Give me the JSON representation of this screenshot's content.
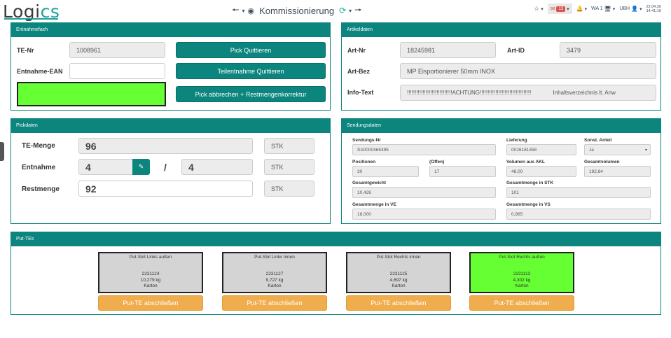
{
  "header": {
    "logo_text_1": "Logi",
    "logo_text_2": "cs",
    "title": "Kommissionierung",
    "mail_count": "13",
    "user_wa": "WA 1",
    "user_name": "UBH",
    "date": "22.04.26",
    "time": "14:41:16"
  },
  "entnahmefach": {
    "heading": "Entnahmefach",
    "te_nr_label": "TE-Nr",
    "te_nr_value": "1008961",
    "ean_label": "Entnahme-EAN",
    "ean_value": "",
    "status_color": "#66ff33",
    "btn_pick": "Pick Quittieren",
    "btn_teil": "Teilentnahme Quittieren",
    "btn_abbrechen": "Pick abbrechen + Restmengenkorrektur"
  },
  "artikeldaten": {
    "heading": "Artikeldaten",
    "art_nr_label": "Art-Nr",
    "art_nr_value": "18245981",
    "art_id_label": "Art-ID",
    "art_id_value": "3479",
    "art_bez_label": "Art-Bez",
    "art_bez_value": "MP Eisportionierer 50mm INOX",
    "info_label": "Info-Text",
    "info_value": "!!!!!!!!!!!!!!!!!!!!!!!!!!!!!ACHTUNG!!!!!!!!!!!!!!!!!!!!!!!!!!!!!!!!!              Inhaltsverzeichnis lt. Anw"
  },
  "pickdaten": {
    "heading": "Pickdaten",
    "te_menge_label": "TE-Menge",
    "te_menge_value": "96",
    "te_menge_unit": "STK",
    "entnahme_label": "Entnahme",
    "entnahme_value": "4",
    "entnahme_sep": "/",
    "entnahme_total": "4",
    "entnahme_unit": "STK",
    "rest_label": "Restmenge",
    "rest_value": "92",
    "rest_unit": "STK"
  },
  "sendungsdaten": {
    "heading": "Sendungsdaten",
    "sendungs_nr_label": "Sendungs-Nr",
    "sendungs_nr_value": "SA0000465395",
    "lieferung_label": "Lieferung",
    "lieferung_value": "0026181358",
    "sonst_label": "Sonst. Anteil",
    "sonst_value": "Ja",
    "positionen_label": "Positionen",
    "positionen_value": "30",
    "offen_label": "(Offen)",
    "offen_value": "17",
    "vol_akl_label": "Volumen aus AKL",
    "vol_akl_value": "48,00",
    "gesamtvolumen_label": "Gesamtvolumen",
    "gesamtvolumen_value": "192,64",
    "gesamtgewicht_label": "Gesamtgewicht",
    "gesamtgewicht_value": "10,426",
    "menge_stk_label": "Gesamtmenge in STK",
    "menge_stk_value": "101",
    "menge_ve_label": "Gesamtmenge in VE",
    "menge_ve_value": "18,000",
    "menge_vs_label": "Gesamtmenge in VS",
    "menge_vs_value": "0,965"
  },
  "put_tes": {
    "heading": "Put-TEs",
    "slots": [
      {
        "title": "Put-Slot Links außen",
        "nr": "2231124",
        "weight": "10,279 kg",
        "type": "Karton",
        "color": "#d4d4d4",
        "button": "Put-TE abschließen"
      },
      {
        "title": "Put-Slot Links innen",
        "nr": "2231127",
        "weight": "9,727 kg",
        "type": "Karton",
        "color": "#d4d4d4",
        "button": "Put-TE abschließen"
      },
      {
        "title": "Put-Slot Rechts innen",
        "nr": "2231125",
        "weight": "4,697 kg",
        "type": "Karton",
        "color": "#d4d4d4",
        "button": "Put-TE abschließen"
      },
      {
        "title": "Put-Slot Rechts außen",
        "nr": "2231113",
        "weight": "4,302 kg",
        "type": "Karton",
        "color": "#66ff33",
        "button": "Put-TE abschließen"
      }
    ]
  }
}
